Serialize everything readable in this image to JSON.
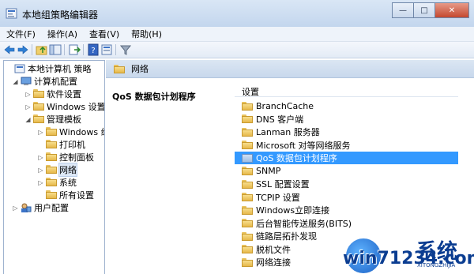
{
  "window": {
    "title": "本地组策略编辑器",
    "minimize_label": "—",
    "maximize_label": "□",
    "close_label": "✕"
  },
  "menu": [
    "文件(F)",
    "操作(A)",
    "查看(V)",
    "帮助(H)"
  ],
  "tree": {
    "root": "本地计算机 策略",
    "computer_config": "计算机配置",
    "software_settings": "软件设置",
    "windows_settings": "Windows 设置",
    "admin_templates": "管理模板",
    "windows_components": "Windows 组",
    "printers": "打印机",
    "control_panel": "控制面板",
    "network": "网络",
    "system": "系统",
    "all_settings": "所有设置",
    "user_config": "用户配置"
  },
  "header": {
    "title": "网络"
  },
  "detail": {
    "title": "QoS 数据包计划程序"
  },
  "list": {
    "column": "设置",
    "items": [
      "BranchCache",
      "DNS 客户端",
      "Lanman 服务器",
      "Microsoft 对等网络服务",
      "QoS 数据包计划程序",
      "SNMP",
      "SSL 配置设置",
      "TCPIP 设置",
      "Windows立即连接",
      "后台智能传送服务(BITS)",
      "链路层拓扑发现",
      "脱机文件",
      "网络连接"
    ],
    "selected_index": 4
  },
  "watermark": {
    "text": "win71234.com",
    "cn": "系统",
    "url": "XITONGZHIJIA"
  }
}
